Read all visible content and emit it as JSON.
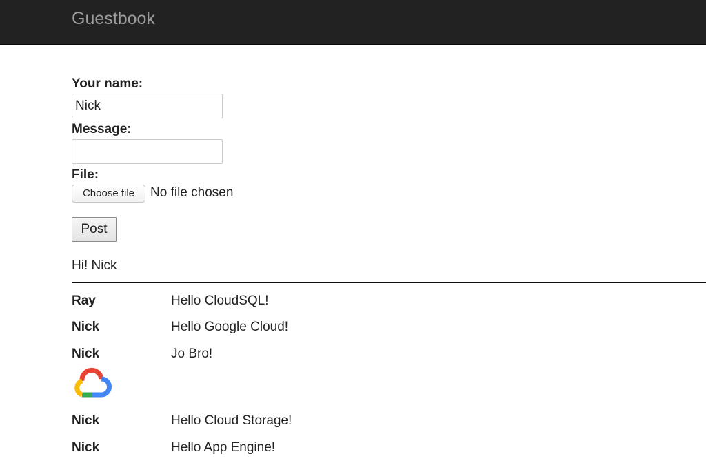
{
  "navbar": {
    "brand": "Guestbook",
    "colors": {
      "background": "#222222",
      "brand_text": "#9d9d9d"
    }
  },
  "form": {
    "name_label": "Your name:",
    "name_value": "Nick",
    "message_label": "Message:",
    "message_value": "",
    "file_label": "File:",
    "file_button_label": "Choose file",
    "file_status": "No file chosen",
    "post_button_label": "Post"
  },
  "greeting": "Hi! Nick",
  "entries": [
    {
      "author": "Ray",
      "message": "Hello CloudSQL!"
    },
    {
      "author": "Nick",
      "message": "Hello Google Cloud!"
    },
    {
      "author": "Nick",
      "message": "Jo Bro!",
      "image": "google-cloud-logo-icon"
    },
    {
      "author": "Nick",
      "message": "Hello Cloud Storage!"
    },
    {
      "author": "Nick",
      "message": "Hello App Engine!"
    }
  ]
}
